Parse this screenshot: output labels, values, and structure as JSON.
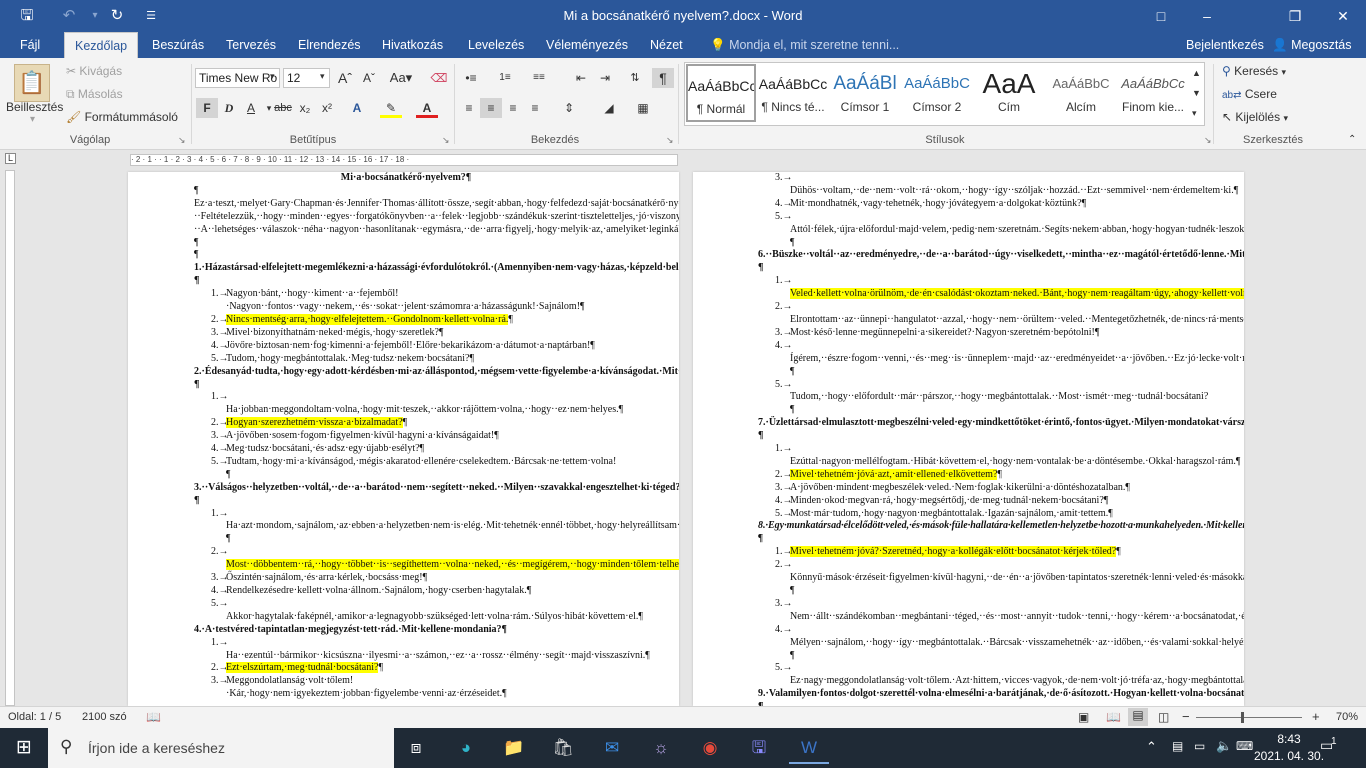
{
  "titlebar": {
    "save_icon": "save-icon",
    "undo_icon": "undo-icon",
    "redo_icon": "redo-icon",
    "title": "Mi a bocsánatkérő nyelvem?.docx - Word",
    "controls": {
      "minimize": "–",
      "restore": "❐",
      "close": "✕"
    }
  },
  "tabs": [
    "Fájl",
    "Kezdőlap",
    "Beszúrás",
    "Tervezés",
    "Elrendezés",
    "Hivatkozás",
    "Levelezés",
    "Véleményezés",
    "Nézet"
  ],
  "active_tab": "Kezdőlap",
  "tell_me_placeholder": "Mondja el, mit szeretne tenni...",
  "signin": "Bejelentkezés",
  "share": "Megosztás",
  "clipboard": {
    "paste": "Beillesztés",
    "cut": "Kivágás",
    "copy": "Másolás",
    "format_painter": "Formátummásoló",
    "label": "Vágólap"
  },
  "font": {
    "name": "Times New Ro",
    "size": "12",
    "bold": "F",
    "italic": "D",
    "underline": "A",
    "strike": "abc",
    "sub": "x₂",
    "sup": "x²",
    "label": "Betűtípus"
  },
  "paragraph": {
    "label": "Bekezdés"
  },
  "styles": {
    "items": [
      {
        "preview": "AaÁáBbCc",
        "name": "¶ Normál"
      },
      {
        "preview": "AaÁáBbCc",
        "name": "¶ Nincs té..."
      },
      {
        "preview": "AaÁáBl",
        "name": "Címsor 1"
      },
      {
        "preview": "AaÁáBbC",
        "name": "Címsor 2"
      },
      {
        "preview": "AaA",
        "name": "Cím"
      },
      {
        "preview": "AaÁáBbC",
        "name": "Alcím"
      },
      {
        "preview": "AaÁáBbCc",
        "name": "Finom kie..."
      }
    ],
    "label": "Stílusok"
  },
  "editing": {
    "find": "Keresés",
    "replace": "Csere",
    "select": "Kijelölés",
    "label": "Szerkesztés"
  },
  "ruler_text": "· 2 · 1 ·  · 1 · 2 · 3 · 4 · 5 · 6 · 7 · 8 · 9 · 10 · 11 · 12 · 13 · 14 · 15 · 16 · 17 · 18 ·",
  "left_page": [
    {
      "k": "t",
      "text": "Mi·a·bocsánatkérő·nyelvem?¶"
    },
    {
      "k": "p",
      "text": "¶"
    },
    {
      "k": "p",
      "text": "Ez·a·teszt,·melyet·Gary·Chapman·és·Jennifer·Thomas·állított·össze,·segít·abban,·hogy·felfedezd·saját·bocsánatkérő·nyelvedet.··Az··alábbiakban··húsz··különböző··helyzetben··öt··különböző·bocsánatkérést·olvashatsz.·Karikázd·be·azt·a·választ,·amelyiket·legszívesebben·hallanál·az·adott·helyzetben!··Feltételezzük,··hogy··minden··egyes··forgatókönyvben··a··felek··legjobb··szándékuk·szerint·tiszteletteljes,·jó·viszonyt·kívánnak·fenntartani·egymással,·a·sérelem·okozója·tudatában·van·helytelen·tettének!··A··lehetséges··válaszok··néha··nagyon··hasonlítanak··egymásra,··de··arra·figyelj,·hogy·melyik·az,·amelyiket·leginkább·hallani·szeretnéd!¶"
    },
    {
      "k": "p",
      "text": "¶"
    },
    {
      "k": "q",
      "text": "1.·Házastársad·elfelejtett·megemlékezni·a·házassági·évfordulótokról.·(Amennyiben·nem·vagy·házas,·képzeld·bele·magadat·ebbe·a·helyzetbe!)·Mit·kellene·mondania?¶"
    },
    {
      "k": "i",
      "n": "1.→",
      "text": "Nagyon·bánt,··hogy··kiment··a··fejemből!·Nagyon··fontos··vagy··nekem,··és··sokat··jelent·számomra·a·házasságunk!·Sajnálom!¶"
    },
    {
      "k": "i",
      "n": "2.→",
      "text": "Nincs·mentség·arra,·hogy·elfelejtettem.··Gondolnom·kellett·volna·rá.",
      "hl": true
    },
    {
      "k": "i",
      "n": "3.→",
      "text": "Mivel·bizonyíthatnám·neked·mégis,·hogy·szeretlek?¶"
    },
    {
      "k": "i",
      "n": "4.→",
      "text": "Jövőre·biztosan·nem·fog·kimenni·a·fejemből!·Előre·bekarikázom·a·dátumot·a·naptárban!¶"
    },
    {
      "k": "i",
      "n": "5.→",
      "text": "Tudom,·hogy·megbántottalak.·Meg·tudsz·nekem·bocsátani?¶"
    },
    {
      "k": "q",
      "text": "2.·Édesanyád·tudta,·hogy·egy·adott·kérdésben·mi·az·álláspontod,·mégsem·vette·figyelembe·a·kívánságodat.·Mit·vársz·tőle,·hogy·mit·mondjon?¶"
    },
    {
      "k": "i",
      "n": "1.→",
      "text": "Ha·jobban·meggondoltam·volna,·hogy·mit·teszek,··akkor·rájöttem·volna,··hogy··ez·nem·helyes.¶"
    },
    {
      "k": "i",
      "n": "2.→",
      "text": "Hogyan·szerezhetném·vissza·a·bizalmadat?",
      "hl": true
    },
    {
      "k": "i",
      "n": "3.→",
      "text": "A·jövőben·sosem·fogom·figyelmen·kívül·hagyni·a·kívánságaidat!¶"
    },
    {
      "k": "i",
      "n": "4.→",
      "text": "Meg·tudsz·bocsátani,·és·adsz·egy·újabb·esélyt?¶"
    },
    {
      "k": "i",
      "n": "5.→",
      "text": "Tudtam,·hogy·mi·a·kívánságod,·mégis·akaratod·ellenére·cselekedtem.·Bárcsak·ne·tettem·volna!¶"
    },
    {
      "k": "q",
      "text": "3.··Válságos··helyzetben··voltál,··de··a··barátod··nem··segített··neked.··Milyen··szavakkal·engesztelhet·ki·téged?¶"
    },
    {
      "k": "i",
      "n": "1.→",
      "text": "Ha·azt·mondom,·sajnálom,·az·ebben·a·helyzetben·nem·is·elég.·Mit·tehetnék·ennél·többet,·hogy·helyreállítsam·a·barátságunkat?¶"
    },
    {
      "k": "i",
      "n": "2.→",
      "text": "Most··döbbentem··rá,··hogy··többet··is··segíthettem··volna··neked,··és··megígérem,··hogy·minden·tőlem·telhetőt·meg·fogok·tenni,·ha·legközelebb·úgy·adódna,·hogy·bajba·kerülsz.",
      "hl": true
    },
    {
      "k": "i",
      "n": "3.→",
      "text": "Őszintén·sajnálom,·és·arra·kérlek,·bocsáss·meg!¶"
    },
    {
      "k": "i",
      "n": "4.→",
      "text": "Rendelkezésedre·kellett·volna·állnom.·Sajnálom,·hogy·cserben·hagytalak.¶"
    },
    {
      "k": "i",
      "n": "5.→",
      "text": "Akkor·hagytalak·faképnél,·amikor·a·legnagyobb·szükséged·lett·volna·rám.·Súlyos·hibát·követtem·el.¶"
    },
    {
      "k": "q",
      "text": "4.·A·testvéred·tapintatlan·megjegyzést·tett·rád.·Mit·kellene·mondania?¶"
    },
    {
      "k": "i",
      "n": "1.→",
      "text": "Ha··ezentúl··bármikor··kicsúszna··ilyesmi··a··számon,··ez··a··rossz··élmény··segít··majd·visszaszívni.¶"
    },
    {
      "k": "i",
      "n": "2.→",
      "text": "Ezt·elszúrtam,·meg·tudnál·bocsátani?",
      "hl": true
    },
    {
      "k": "i",
      "n": "3.→",
      "text": "Meggondolatlanság·volt·tőlem!·Kár,·hogy·nem·igyekeztem·jobban·figyelembe·venni·az·érzéseidet.¶"
    }
  ],
  "right_page": [
    {
      "k": "i",
      "n": "3.→",
      "text": "Dühös··voltam,··de··nem··volt··rá··okom,··hogy··így··szóljak··hozzád.··Ezt··semmivel··nem·érdemeltem·ki.¶"
    },
    {
      "k": "i",
      "n": "4.→",
      "text": "Mit·mondhatnék,·vagy·tehetnék,·hogy·jóvátegyem·a·dolgokat·köztünk?¶"
    },
    {
      "k": "i",
      "n": "5.→",
      "text": "Attól·félek,·újra·előfordul·majd·velem,·pedig·nem·szeretnám.·Segíts·nekem·abban,·hogy·hogyan·tudnék·leszokni·a·kiabálásról!¶"
    },
    {
      "k": "q",
      "text": "6.··Büszke··voltál··az··eredményedre,··de··a··barátod··úgy··viselkedett,··mintha··ez··magától·értetődő·lenne.·Mit·vársz·tőle,·hogy·mondjon,·miután·felismerte·a·hibáját?¶"
    },
    {
      "k": "i",
      "n": "1.→",
      "text": "Veled·kellett·volna·örülnöm,·de·én·csalódást·okoztam·neked.·Bánt,·hogy·nem·reagáltam·úgy,·ahogy·kellett·volna.",
      "hl": true
    },
    {
      "k": "i",
      "n": "2.→",
      "text": "Elrontottam··az··ünnepi··hangulatot··azzal,··hogy··nem··örültem··veled.··Mentegetőzhetnék,·de·nincs·rá·mentség,·hogy·figyelmen·kívül·hagytam·a·teljesítményedet.¶"
    },
    {
      "k": "i",
      "n": "3.→",
      "text": "Most·késő·lenne·megünnepelni·a·sikereidet?·Nagyon·szeretném·bepótolni!¶"
    },
    {
      "k": "i",
      "n": "4.→",
      "text": "Ígérem,··észre·fogom··venni,··és··meg··is··ünneplem··majd··az··eredményeidet··a··jövőben.··Ez·jó·lecke·volt·nekem!¶"
    },
    {
      "k": "i",
      "n": "5.→",
      "text": "Tudom,··hogy··előfordult··már··párszor,··hogy··megbántottalak.··Most··ismét··meg··tudnál·bocsátani?¶"
    },
    {
      "k": "q",
      "text": "7.·Üzlettársad·elmulasztott·megbeszélni·veled·egy·mindkettőtöket·érintő,·fontos·ügyet.·Milyen·mondatokat·vársz·tőle?¶"
    },
    {
      "k": "i",
      "n": "1.→",
      "text": "Ezúttal·nagyon·mellélfogtam.·Hibát·követtem·el,·hogy·nem·vontalak·be·a·döntésembe.·Okkal·haragszol·rám.¶"
    },
    {
      "k": "i",
      "n": "2.→",
      "text": "Mivel·tehetném·jóvá·azt,·amit·ellened·elkövettem?",
      "hl": true
    },
    {
      "k": "i",
      "n": "3.→",
      "text": "A·jövőben·mindent·megbeszélek·veled.·Nem·foglak·kikerülni·a·döntéshozatalban.¶"
    },
    {
      "k": "i",
      "n": "4.→",
      "text": "Minden·okod·megvan·rá,·hogy·megsértődj,·de·meg·tudnál·nekem·bocsátani?¶"
    },
    {
      "k": "i",
      "n": "5.→",
      "text": "Most·már·tudom,·hogy·nagyon·megbántottalak.·Igazán·sajnálom,·amit·tettem.¶"
    },
    {
      "k": "qi",
      "text": "8.·Egy·munkatársad·élcelődött·veled,·és·mások·füle·hallatára·kellemetlen·helyzetbe·hozott·a·munkahelyeden.·Mit·kellene·mondania?¶"
    },
    {
      "k": "i",
      "n": "1.→",
      "text": "Mivel·tehetném·jóvá?·Szeretnéd,·hogy·a·kollégák·előtt·bocsánatot·kérjek·tőled?",
      "hl": true
    },
    {
      "k": "i",
      "n": "2.→",
      "text": "Könnyű·mások·érzéseit·figyelmen·kívül·hagyni,··de··én··a·jövőben·tapintatos·szeretnék·lenni·veled·és·másokkal.·Tudnál·figyelmeztetni·arra,·hogy·ezt·betartsam?¶"
    },
    {
      "k": "i",
      "n": "3.→",
      "text": "Nem··állt··szándékomban··megbántani··téged,··és··most··annyit··tudok··tenni,··hogy··kérem··a·bocsánatodat,·és·megpróbálom·nem·elkövetni·ugyanazt·a·hibát·még·egyszer.¶"
    },
    {
      "k": "i",
      "n": "4.→",
      "text": "Mélyen··sajnálom,··hogy··így··megbántottalak.··Bárcsak··visszamehetnék··az··időben,··és·valami·sokkal·helyénvalóbbat·mondhatnék!¶"
    },
    {
      "k": "i",
      "n": "5.→",
      "text": "Ez·nagy·meggondolatlanság·volt·tőlem.·Azt·hittem,·vicces·vagyok,·de·nem·volt·jó·tréfa·az,·hogy·megbántottalak.¶"
    },
    {
      "k": "q",
      "text": "9.·Valamilyen·fontos·dolgot·szerettél·volna·elmesélni·a·barátjának,·de·ő·ásítozott.·Hogyan·kellett·volna·bocsánatot·kérnie?¶"
    },
    {
      "k": "i",
      "n": "1.→",
      "text": "Ezúttal·elszúrtam,·de·megígérem,·hogy·legközelebb·teljes·odaadással·fogok·figyelni·rád,·amikor·valami·fontosat·akarsz·nekem·mondani.",
      "hl": true
    },
    {
      "k": "i",
      "n": "2.→",
      "text": "Sajnálom,··hogy··nem··figyeltem.··Nem··kényszeríthetlek,··hogy··megbocsáss,··de··azért·remélem,·hogy·mégis·megteszed.¶"
    },
    {
      "k": "i",
      "n": "3.→",
      "text": "Nagyon·kellemetlenül·érzem·magamat·azért,·hogy·nem·figyeltem·arra,·amit·mondasz.¶"
    }
  ],
  "status": {
    "page": "Oldal: 1 / 5",
    "words": "2100 szó",
    "zoom": "70%"
  },
  "taskbar": {
    "search_placeholder": "Írjon ide a kereséshez",
    "time": "8:43",
    "date": "2021. 04. 30.",
    "notifications": "1"
  }
}
